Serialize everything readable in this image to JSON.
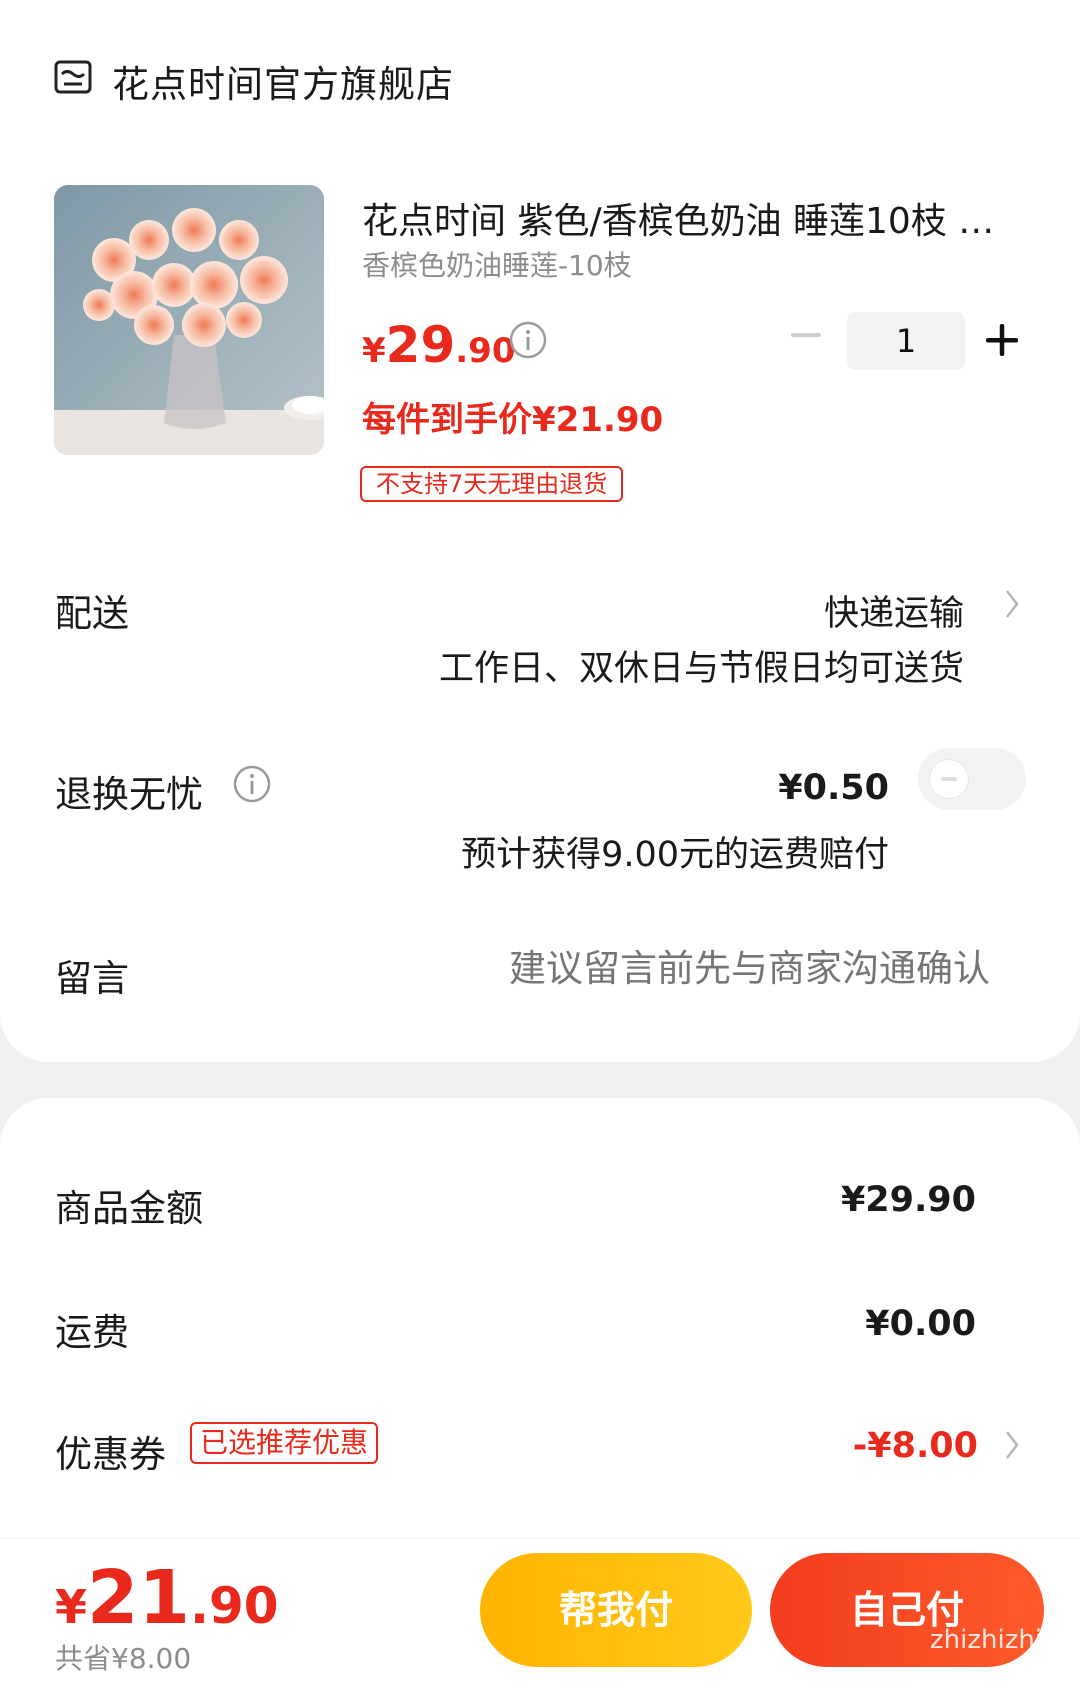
{
  "store": {
    "name": "花点时间官方旗舰店",
    "icon": "store-icon"
  },
  "product": {
    "title": "花点时间 紫色/香槟色奶油 睡莲10枝 …",
    "sku": "香槟色奶油睡莲-10枝",
    "price_symbol": "¥",
    "price_int": "29",
    "price_dec": ".90",
    "net_price": "每件到手价¥21.90",
    "return_policy": "不支持7天无理由退货",
    "quantity": "1"
  },
  "delivery": {
    "label": "配送",
    "value": "快递运输",
    "sub": "工作日、双休日与节假日均可送货"
  },
  "return_worry": {
    "label": "退换无忧",
    "value": "¥0.50",
    "sub": "预计获得9.00元的运费赔付",
    "enabled": false
  },
  "note": {
    "label": "留言",
    "placeholder": "建议留言前先与商家沟通确认"
  },
  "summary": {
    "goods_label": "商品金额",
    "goods_value": "¥29.90",
    "shipping_label": "运费",
    "shipping_value": "¥0.00",
    "coupon_label": "优惠券",
    "coupon_badge": "已选推荐优惠",
    "coupon_value": "-¥8.00"
  },
  "footer": {
    "total_symbol": "¥",
    "total_int": "21",
    "total_dec": ".90",
    "saved": "共省¥8.00",
    "help_pay_label": "帮我付",
    "self_pay_label": "自己付",
    "watermark": "zhizhizhi.com"
  },
  "colors": {
    "accent": "#e8291c",
    "help_button": "#ffbc0d",
    "self_button": "#f5401f"
  }
}
